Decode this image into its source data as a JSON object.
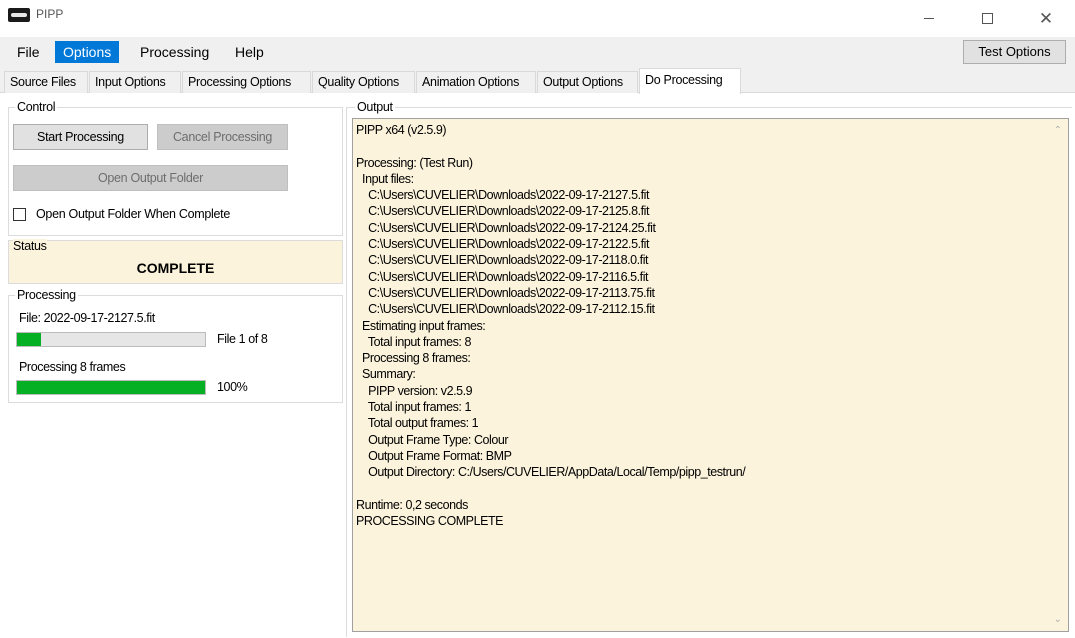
{
  "window": {
    "title": "PIPP"
  },
  "menu": {
    "file": "File",
    "options": "Options",
    "processing": "Processing",
    "help": "Help",
    "test_options": "Test Options"
  },
  "tabs": [
    "Source Files",
    "Input Options",
    "Processing Options",
    "Quality Options",
    "Animation Options",
    "Output Options",
    "Do Processing"
  ],
  "control": {
    "label": "Control",
    "start_processing": "Start Processing",
    "cancel_processing": "Cancel Processing",
    "open_output_folder": "Open Output Folder",
    "open_when_complete": "Open Output Folder When Complete",
    "open_when_complete_checked": false
  },
  "status": {
    "label": "Status",
    "value": "COMPLETE"
  },
  "processing": {
    "label": "Processing",
    "file_text": "File: 2022-09-17-2127.5.fit",
    "file_count": "File 1 of 8",
    "file_progress": 0.125,
    "frames_text": "Processing 8 frames",
    "frames_percent": "100%",
    "frames_progress": 1.0
  },
  "output": {
    "label": "Output",
    "lines": "PIPP x64 (v2.5.9)\n\nProcessing: (Test Run)\n  Input files:\n    C:\\Users\\CUVELIER\\Downloads\\2022-09-17-2127.5.fit\n    C:\\Users\\CUVELIER\\Downloads\\2022-09-17-2125.8.fit\n    C:\\Users\\CUVELIER\\Downloads\\2022-09-17-2124.25.fit\n    C:\\Users\\CUVELIER\\Downloads\\2022-09-17-2122.5.fit\n    C:\\Users\\CUVELIER\\Downloads\\2022-09-17-2118.0.fit\n    C:\\Users\\CUVELIER\\Downloads\\2022-09-17-2116.5.fit\n    C:\\Users\\CUVELIER\\Downloads\\2022-09-17-2113.75.fit\n    C:\\Users\\CUVELIER\\Downloads\\2022-09-17-2112.15.fit\n  Estimating input frames:\n    Total input frames: 8\n  Processing 8 frames:\n  Summary:\n    PIPP version: v2.5.9\n    Total input frames: 1\n    Total output frames: 1\n    Output Frame Type: Colour\n    Output Frame Format: BMP\n    Output Directory: C:/Users/CUVELIER/AppData/Local/Temp/pipp_testrun/\n\nRuntime: 0,2 seconds\nPROCESSING COMPLETE"
  },
  "colors": {
    "accent": "#0078d7",
    "progress_green": "#06b025",
    "output_background": "#fbf3dc"
  }
}
